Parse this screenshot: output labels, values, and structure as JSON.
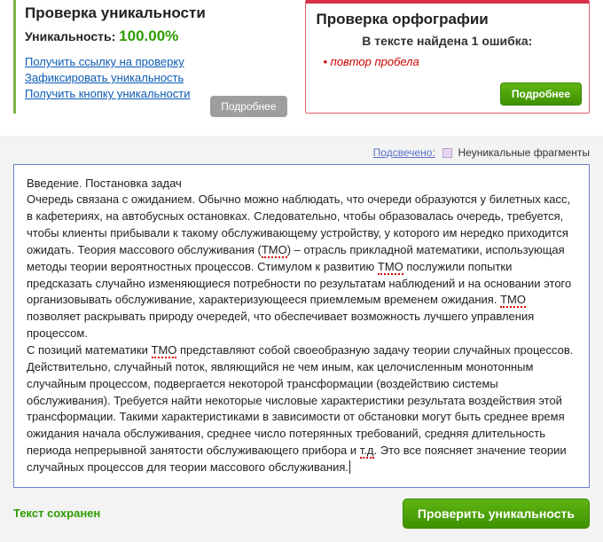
{
  "unique_panel": {
    "title": "Проверка уникальности",
    "label": "Уникальность:",
    "value": "100.00%",
    "links": [
      "Получить ссылку на проверку",
      "Зафиксировать уникальность",
      "Получить кнопку уникальности"
    ],
    "more_btn": "Подробнее"
  },
  "ortho_panel": {
    "title": "Проверка орфографии",
    "subtitle": "В тексте найдена 1 ошибка:",
    "errors": [
      "повтор пробела"
    ],
    "more_btn": "Подробнее"
  },
  "legend": {
    "highlighted": "Подсвечено:",
    "non_unique": "Неуникальные фрагменты"
  },
  "text": {
    "p1": "Введение. Постановка задач",
    "p2a": "Очередь связана с ожиданием. Обычно можно наблюдать, что очереди образуются у билетных касс, в кафетериях, на автобусных остановках. Следовательно, чтобы образовалась очередь, требуется, чтобы клиенты прибывали к такому обслуживающему устройству, у которого им нередко приходится ожидать. Теория массового обслуживания (",
    "tmo": "ТМО",
    "p2b": ") – отрасль прикладной математики, использующая методы теории вероятностных процессов. Стимулом к развитию ",
    "p2c": " послужили попытки предсказать случайно изменяющиеся потребности по результатам наблюдений и на основании этого организовывать обслуживание, характеризующееся приемлемым временем ожидания. ",
    "p2d": " позволяет раскрывать природу очередей, что обеспечивает возможность лучшего управления процессом.",
    "p3a": "С позиций математики ",
    "p3b": " представляют собой своеобразную задачу теории случайных процессов. Действительно, случайный поток, являющийся не чем иным, как целочисленным монотонным случайным процессом, подвергается некоторой трансформации (воздействию системы обслуживания). Требуется найти некоторые числовые характеристики результата воздействия этой трансформации. Такими характеристиками в зависимости от обстановки могут быть среднее время ожидания начала обслуживания, среднее число потерянных требований, средняя длительность периода непрерывной занятости обслуживающего прибора и ",
    "td": "т.д",
    "p3c": ".  Это все поясняет значение теории случайных процессов для теории массового обслуживания."
  },
  "footer": {
    "saved": "Текст сохранен",
    "check_btn": "Проверить уникальность"
  }
}
